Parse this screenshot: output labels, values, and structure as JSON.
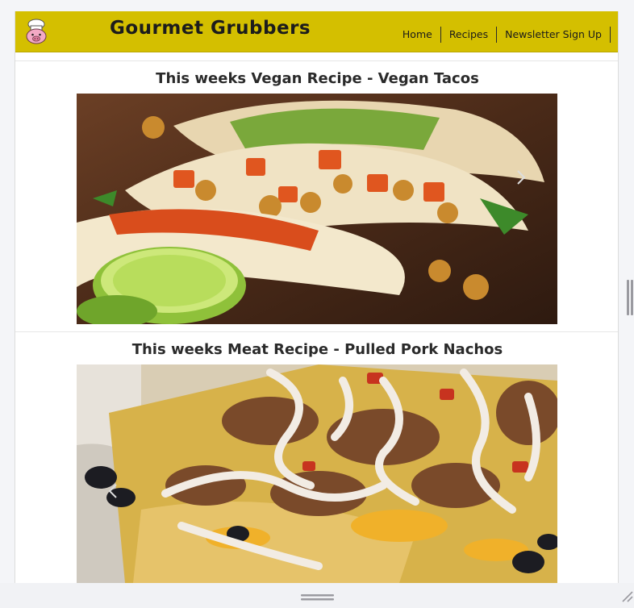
{
  "header": {
    "brand": "Gourmet Grubbers",
    "logo_icon": "chef-pig-icon",
    "background": "#d4bf00",
    "nav": [
      "Home",
      "Recipes",
      "Newsletter Sign Up"
    ]
  },
  "recipes": [
    {
      "title": "This weeks Vegan Recipe - Vegan Tacos",
      "image": "vegan-tacos-photo",
      "control": "carousel-next-arrow"
    },
    {
      "title": "This weeks Meat Recipe - Pulled Pork Nachos",
      "image": "pulled-pork-nachos-photo",
      "control": "carousel-prev-arrow"
    }
  ]
}
